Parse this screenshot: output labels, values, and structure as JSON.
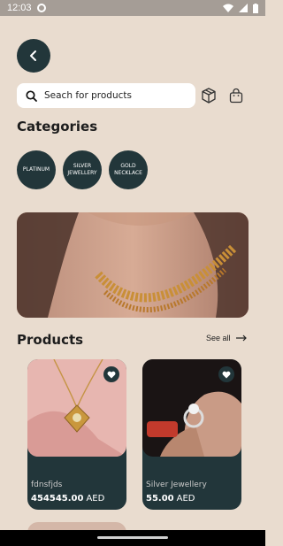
{
  "status_bar": {
    "time": "12:03"
  },
  "search": {
    "placeholder": "Seach for products"
  },
  "categories": {
    "title": "Categories",
    "items": [
      {
        "label": "PLATINUM"
      },
      {
        "label": "SILVER JEWELLERY"
      },
      {
        "label": "GOLD NECKLACE"
      }
    ]
  },
  "products": {
    "title": "Products",
    "see_all_label": "See all",
    "items": [
      {
        "name": "fdnsfjds",
        "price": "454545.00",
        "currency": "AED"
      },
      {
        "name": "Silver Jewellery",
        "price": "55.00",
        "currency": "AED"
      }
    ]
  },
  "colors": {
    "background": "#e9dccf",
    "accent": "#22363a"
  },
  "icons": [
    "back-arrow-icon",
    "search-icon",
    "box-icon",
    "shopping-bag-icon",
    "arrow-right-icon",
    "heart-icon"
  ]
}
